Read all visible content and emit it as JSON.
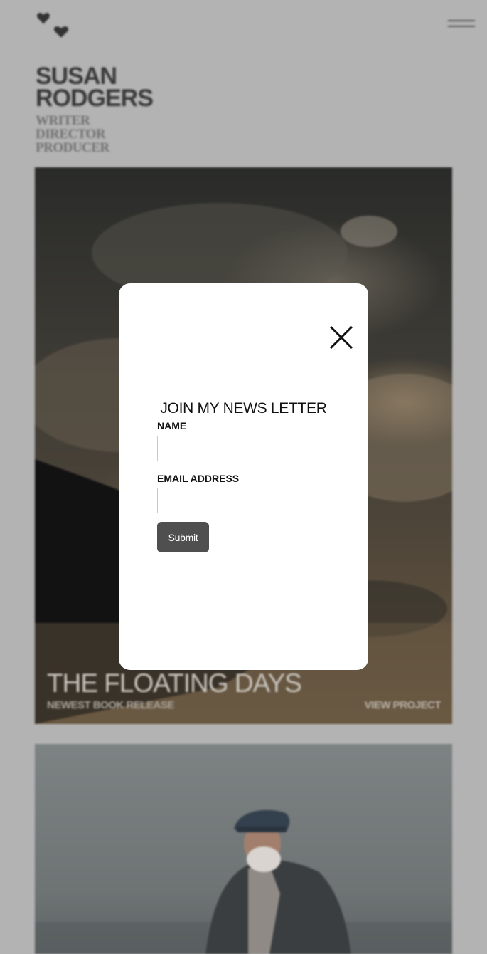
{
  "header": {
    "logo_icon": "heart-pair-logo",
    "menu_icon": "hamburger-menu-icon"
  },
  "hero": {
    "name_line1": "SUSAN",
    "name_line2": "RODGERS",
    "roles": [
      "WRITER",
      "DIRECTOR",
      "PRODUCER"
    ]
  },
  "projects": [
    {
      "title": "THE FLOATING DAYS",
      "subtitle": "NEWEST BOOK RELEASE",
      "link_label": "VIEW PROJECT"
    }
  ],
  "newsletter_modal": {
    "title": "JOIN MY NEWS LETTER",
    "name_label": "NAME",
    "name_value": "",
    "email_label": "EMAIL ADDRESS",
    "email_value": "",
    "submit_label": "Submit",
    "close_icon": "close-icon"
  },
  "colors": {
    "overlay": "#b3b3b3",
    "submit_bg": "#4f4f4f",
    "modal_bg": "#ffffff"
  }
}
